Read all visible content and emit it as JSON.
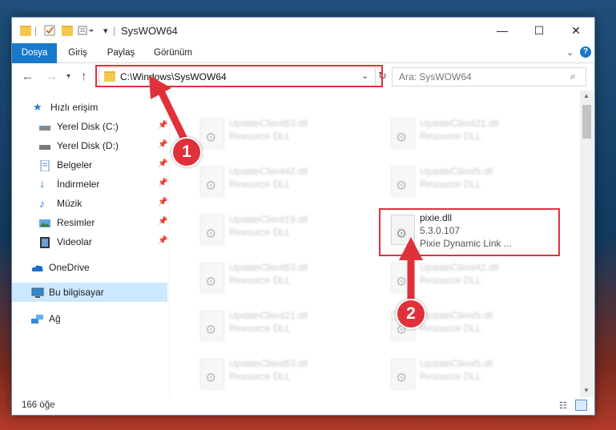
{
  "window": {
    "title": "SysWOW64",
    "controls": {
      "minimize": "—",
      "maximize": "☐",
      "close": "✕"
    }
  },
  "ribbon": {
    "tabs": [
      "Dosya",
      "Giriş",
      "Paylaş",
      "Görünüm"
    ],
    "expand_icon": "chevron-down",
    "help_icon": "?"
  },
  "navigation": {
    "address": "C:\\Windows\\SysWOW64",
    "search_placeholder": "Ara: SysWOW64"
  },
  "sidebar": {
    "quick_access": "Hızlı erişim",
    "pinned": [
      {
        "label": "Yerel Disk (C:)",
        "icon": "drive-icon"
      },
      {
        "label": "Yerel Disk (D:)",
        "icon": "drive-icon"
      },
      {
        "label": "Belgeler",
        "icon": "documents-icon"
      },
      {
        "label": "İndirmeler",
        "icon": "downloads-icon"
      },
      {
        "label": "Müzik",
        "icon": "music-icon"
      },
      {
        "label": "Resimler",
        "icon": "pictures-icon"
      },
      {
        "label": "Videolar",
        "icon": "videos-icon"
      }
    ],
    "onedrive": "OneDrive",
    "this_pc": "Bu bilgisayar",
    "network": "Ağ"
  },
  "files": [
    {
      "name": "UpdateClient63.dll",
      "type": "Resource DLL"
    },
    {
      "name": "UpdateClient21.dll",
      "type": "Resource DLL"
    },
    {
      "name": "UpdateClient42.dll",
      "type": "Resource DLL"
    },
    {
      "name": "UpdateClient5.dll",
      "type": "Resource DLL"
    },
    {
      "name": "UpdateClient19.dll",
      "type": "Resource DLL"
    },
    {
      "name": "pixie.dll",
      "version": "5.3.0.107",
      "desc": "Pixie Dynamic Link ..."
    },
    {
      "name": "UpdateClient63.dll",
      "type": "Resource DLL"
    },
    {
      "name": "UpdateClient42.dll",
      "type": "Resource DLL"
    },
    {
      "name": "UpdateClient21.dll",
      "type": "Resource DLL"
    },
    {
      "name": "UpdateClient5.dll",
      "type": "Resource DLL"
    },
    {
      "name": "UpdateClient63.dll",
      "type": "Resource DLL"
    },
    {
      "name": "UpdateClient5.dll",
      "type": "Resource DLL"
    }
  ],
  "status": {
    "item_count": "166 öğe"
  },
  "annotations": {
    "step1": "1",
    "step2": "2"
  },
  "colors": {
    "accent": "#1979ca",
    "highlight": "#e0313b",
    "selection": "#cce8ff"
  }
}
